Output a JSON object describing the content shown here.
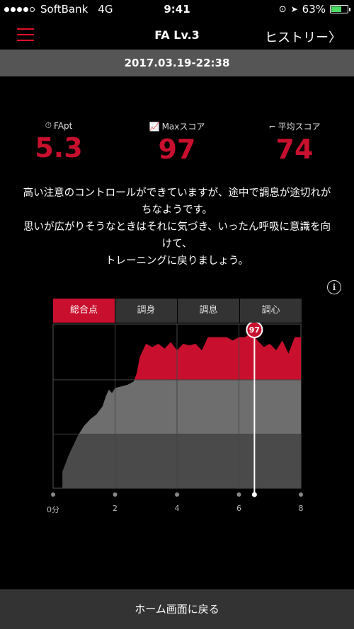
{
  "status": {
    "carrier": "SoftBank",
    "network": "4G",
    "time": "9:41",
    "battery": "63%"
  },
  "nav": {
    "title": "FA Lv.3",
    "history": "ヒストリー〉"
  },
  "date": "2017.03.19-22:38",
  "stats": [
    {
      "label": "FApt",
      "value": "5.3"
    },
    {
      "label": "Maxスコア",
      "value": "97"
    },
    {
      "label": "平均スコア",
      "value": "74"
    }
  ],
  "message": [
    "高い注意のコントロールができていますが、途中で調息が途切れが",
    "ちなようです。",
    "思いが広がりそうなときはそれに気づき、いったん呼吸に意識を向",
    "けて、",
    "トレーニングに戻りましょう。"
  ],
  "tabs": [
    "総合点",
    "調身",
    "調息",
    "調心"
  ],
  "home_button": "ホーム画面に戻る",
  "chart_data": {
    "type": "area",
    "x_ticks": [
      "0分",
      "2",
      "4",
      "6",
      "8"
    ],
    "xlim": [
      0,
      8
    ],
    "ylim": [
      0,
      100
    ],
    "bands": [
      33,
      66
    ],
    "marker": {
      "x": 6.5,
      "value": 97
    },
    "highlight_color": "#c8102e",
    "band_colors": [
      "#4a4a4a",
      "#6e6e6e"
    ],
    "series": [
      {
        "x": [
          0.3,
          0.5,
          0.8,
          1.0,
          1.2,
          1.4,
          1.6,
          1.7,
          1.8,
          1.9,
          2.0,
          2.2,
          2.4,
          2.6,
          2.7,
          2.8,
          3.0,
          3.2,
          3.4,
          3.6,
          3.8,
          4.0,
          4.2,
          4.4,
          4.6,
          4.8,
          5.0,
          5.2,
          5.4,
          5.6,
          5.8,
          6.0,
          6.2,
          6.4,
          6.6,
          6.8,
          7.0,
          7.2,
          7.4,
          7.6,
          7.8,
          8.0
        ],
        "y": [
          10,
          20,
          32,
          38,
          42,
          45,
          50,
          56,
          60,
          58,
          61,
          62,
          63,
          65,
          70,
          80,
          88,
          86,
          88,
          85,
          89,
          84,
          88,
          87,
          88,
          84,
          92,
          92,
          92,
          92,
          90,
          92,
          92,
          95,
          90,
          86,
          88,
          84,
          90,
          82,
          92,
          92
        ]
      }
    ]
  }
}
